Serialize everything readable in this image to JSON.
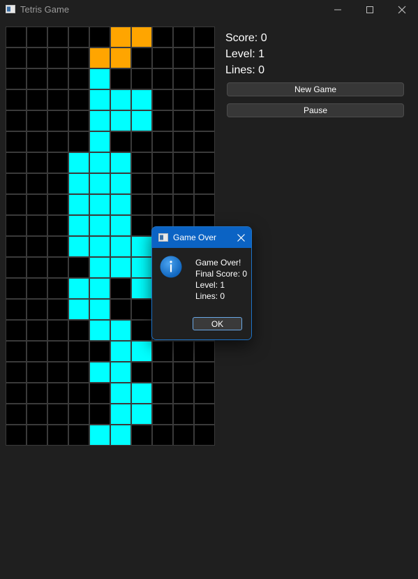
{
  "window": {
    "title": "Tetris Game",
    "controls": [
      "minimize",
      "maximize",
      "close"
    ]
  },
  "board": {
    "cols": 10,
    "rows": 20,
    "cells": [
      [
        0,
        5,
        "orange"
      ],
      [
        0,
        6,
        "orange"
      ],
      [
        1,
        4,
        "orange"
      ],
      [
        1,
        5,
        "orange"
      ],
      [
        2,
        4,
        "cyan"
      ],
      [
        3,
        4,
        "cyan"
      ],
      [
        3,
        5,
        "cyan"
      ],
      [
        3,
        6,
        "cyan"
      ],
      [
        4,
        4,
        "cyan"
      ],
      [
        4,
        5,
        "cyan"
      ],
      [
        4,
        6,
        "cyan"
      ],
      [
        5,
        4,
        "cyan"
      ],
      [
        6,
        3,
        "cyan"
      ],
      [
        6,
        4,
        "cyan"
      ],
      [
        6,
        5,
        "cyan"
      ],
      [
        7,
        3,
        "cyan"
      ],
      [
        7,
        4,
        "cyan"
      ],
      [
        7,
        5,
        "cyan"
      ],
      [
        8,
        3,
        "cyan"
      ],
      [
        8,
        4,
        "cyan"
      ],
      [
        8,
        5,
        "cyan"
      ],
      [
        9,
        3,
        "cyan"
      ],
      [
        9,
        4,
        "cyan"
      ],
      [
        9,
        5,
        "cyan"
      ],
      [
        10,
        3,
        "cyan"
      ],
      [
        10,
        4,
        "cyan"
      ],
      [
        10,
        5,
        "cyan"
      ],
      [
        10,
        6,
        "cyan"
      ],
      [
        11,
        4,
        "cyan"
      ],
      [
        11,
        5,
        "cyan"
      ],
      [
        11,
        6,
        "cyan"
      ],
      [
        12,
        3,
        "cyan"
      ],
      [
        12,
        4,
        "cyan"
      ],
      [
        12,
        6,
        "cyan"
      ],
      [
        13,
        3,
        "cyan"
      ],
      [
        13,
        4,
        "cyan"
      ],
      [
        14,
        4,
        "cyan"
      ],
      [
        14,
        5,
        "cyan"
      ],
      [
        15,
        5,
        "cyan"
      ],
      [
        15,
        6,
        "cyan"
      ],
      [
        16,
        4,
        "cyan"
      ],
      [
        16,
        5,
        "cyan"
      ],
      [
        17,
        5,
        "cyan"
      ],
      [
        17,
        6,
        "cyan"
      ],
      [
        18,
        5,
        "cyan"
      ],
      [
        18,
        6,
        "cyan"
      ],
      [
        19,
        4,
        "cyan"
      ],
      [
        19,
        5,
        "cyan"
      ]
    ]
  },
  "colors": {
    "cyan": "#00ffff",
    "orange": "#ffa500",
    "empty": "#000000",
    "grid": "#3a3a3a",
    "accent": "#0b63c4"
  },
  "stats": {
    "score": "Score: 0",
    "level": "Level: 1",
    "lines": "Lines: 0"
  },
  "buttons": {
    "new_game": "New Game",
    "pause": "Pause"
  },
  "dialog": {
    "title": "Game Over",
    "icon": "info-icon",
    "lines": [
      "Game Over!",
      "Final Score: 0",
      "Level: 1",
      "Lines: 0"
    ],
    "ok": "OK"
  }
}
